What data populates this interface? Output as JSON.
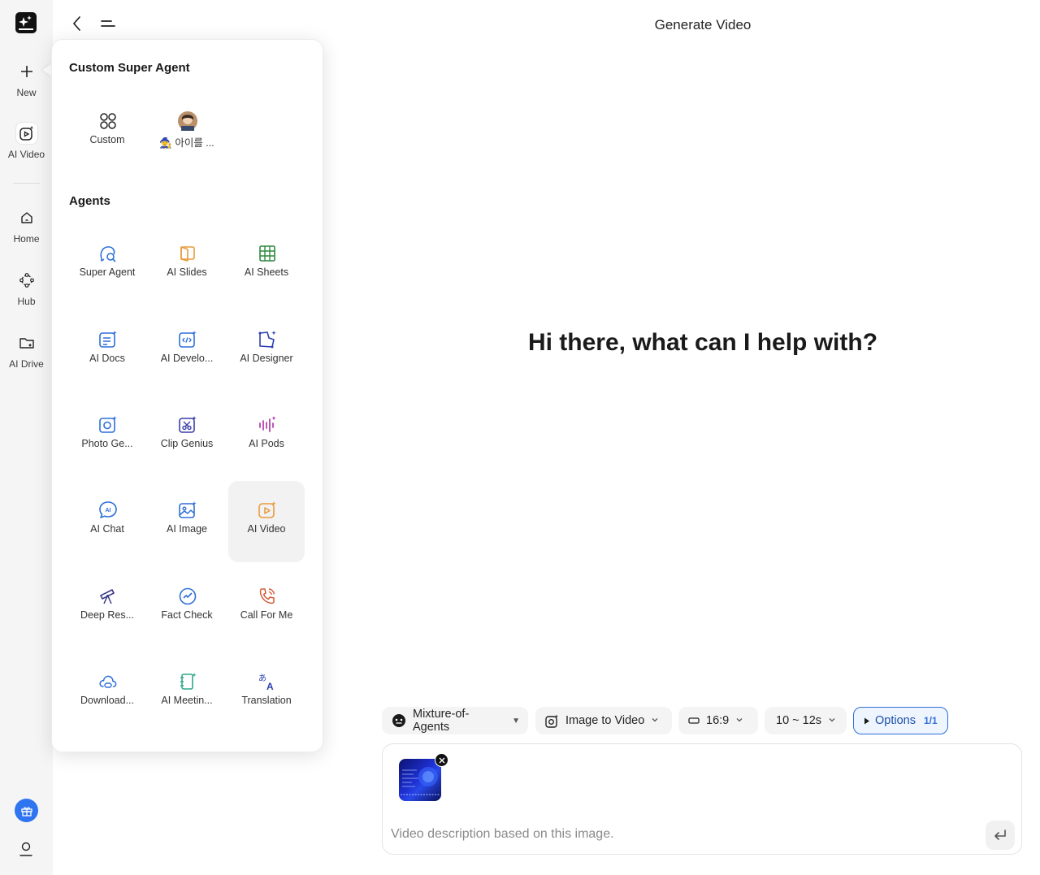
{
  "header": {
    "title": "Generate Video"
  },
  "rail": {
    "items": [
      {
        "label": "New",
        "icon": "plus-icon"
      },
      {
        "label": "AI Video",
        "icon": "ai-video-icon"
      },
      {
        "label": "Home",
        "icon": "home-icon"
      },
      {
        "label": "Hub",
        "icon": "hub-icon"
      },
      {
        "label": "AI Drive",
        "icon": "drive-icon"
      }
    ]
  },
  "popup": {
    "custom_title": "Custom Super Agent",
    "custom_items": [
      {
        "label": "Custom",
        "icon": "grid-circles-icon"
      },
      {
        "label": "🧙 아이를 ...",
        "icon": "avatar-image"
      }
    ],
    "agents_title": "Agents",
    "agents": [
      {
        "label": "Super Agent",
        "icon": "super-agent-icon",
        "color": "#2e6fd8"
      },
      {
        "label": "AI Slides",
        "icon": "slides-icon",
        "color": "#e89a3c"
      },
      {
        "label": "AI Sheets",
        "icon": "sheets-icon",
        "color": "#2f8a3e"
      },
      {
        "label": "AI Docs",
        "icon": "docs-icon",
        "color": "#2e6fd8"
      },
      {
        "label": "AI Develo...",
        "icon": "developer-icon",
        "color": "#2e6fd8"
      },
      {
        "label": "AI Designer",
        "icon": "designer-icon",
        "color": "#2a3fb0"
      },
      {
        "label": "Photo Ge...",
        "icon": "photo-genius-icon",
        "color": "#2e6fd8"
      },
      {
        "label": "Clip Genius",
        "icon": "clip-genius-icon",
        "color": "#3a3fa8"
      },
      {
        "label": "AI Pods",
        "icon": "pods-icon",
        "color": "#b03aa8"
      },
      {
        "label": "AI Chat",
        "icon": "chat-icon",
        "color": "#2e6fd8"
      },
      {
        "label": "AI Image",
        "icon": "image-icon",
        "color": "#2e6fd8"
      },
      {
        "label": "AI Video",
        "icon": "video-icon",
        "color": "#e89a3c"
      },
      {
        "label": "Deep Res...",
        "icon": "telescope-icon",
        "color": "#3a3a8a"
      },
      {
        "label": "Fact Check",
        "icon": "fact-check-icon",
        "color": "#2e6fd8"
      },
      {
        "label": "Call For Me",
        "icon": "phone-icon",
        "color": "#d45a3a"
      },
      {
        "label": "Download...",
        "icon": "cloud-download-icon",
        "color": "#2e6fd8"
      },
      {
        "label": "AI Meetin...",
        "icon": "meeting-icon",
        "color": "#2fa88a"
      },
      {
        "label": "Translation",
        "icon": "translate-icon",
        "color": "#2a3fb0"
      }
    ]
  },
  "main": {
    "greeting": "Hi there, what can I help with?"
  },
  "toolbar": {
    "model": "Mixture-of-Agents",
    "mode": "Image to Video",
    "ratio": "16:9",
    "duration": "10 ~ 12s",
    "options_label": "Options",
    "options_count": "1/1"
  },
  "composer": {
    "prompt_value": "Video description based on this image."
  }
}
